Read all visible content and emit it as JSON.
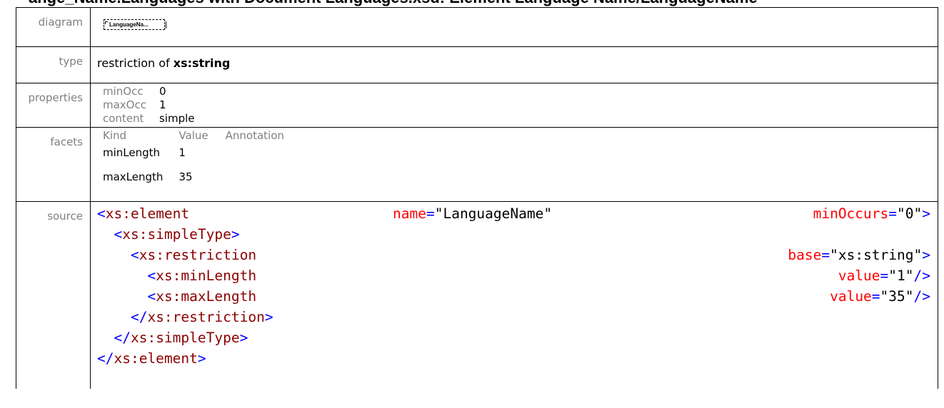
{
  "header_text": "ange_Name.Languages with Document Languages.xsd: Element Language Name/LanguageName",
  "rows": {
    "diagram": {
      "label": "diagram",
      "box_text": "LanguageNa..."
    },
    "type": {
      "label": "type",
      "prefix": "restriction of ",
      "base": "xs:string"
    },
    "properties": {
      "label": "properties",
      "items": [
        {
          "key": "minOcc",
          "value": "0"
        },
        {
          "key": "maxOcc",
          "value": "1"
        },
        {
          "key": "content",
          "value": "simple"
        }
      ]
    },
    "facets": {
      "label": "facets",
      "headers": [
        "Kind",
        "Value",
        "Annotation"
      ],
      "items": [
        {
          "kind": "minLength",
          "value": "1"
        },
        {
          "kind": "maxLength",
          "value": "35"
        }
      ]
    },
    "source": {
      "label": "source",
      "l1": {
        "open": "<",
        "tag": "xs:element",
        "attr1": "name",
        "eq1": "=",
        "val1": "\"LanguageName\"",
        "attr2": "minOccurs",
        "eq2": "=",
        "val2": "\"0\"",
        "close": ">"
      },
      "l2": {
        "open": "<",
        "tag": "xs:simpleType",
        "close": ">"
      },
      "l3": {
        "open": "<",
        "tag": "xs:restriction",
        "attr": "base",
        "eq": "=",
        "val": "\"xs:string\"",
        "close": ">"
      },
      "l4": {
        "open": "<",
        "tag": "xs:minLength",
        "attr": "value",
        "eq": "=",
        "val": "\"1\"",
        "close": "/>"
      },
      "l5": {
        "open": "<",
        "tag": "xs:maxLength",
        "attr": "value",
        "eq": "=",
        "val": "\"35\"",
        "close": "/>"
      },
      "l6": {
        "open": "</",
        "tag": "xs:restriction",
        "close": ">"
      },
      "l7": {
        "open": "</",
        "tag": "xs:simpleType",
        "close": ">"
      },
      "l8": {
        "open": "</",
        "tag": "xs:element",
        "close": ">"
      }
    }
  }
}
